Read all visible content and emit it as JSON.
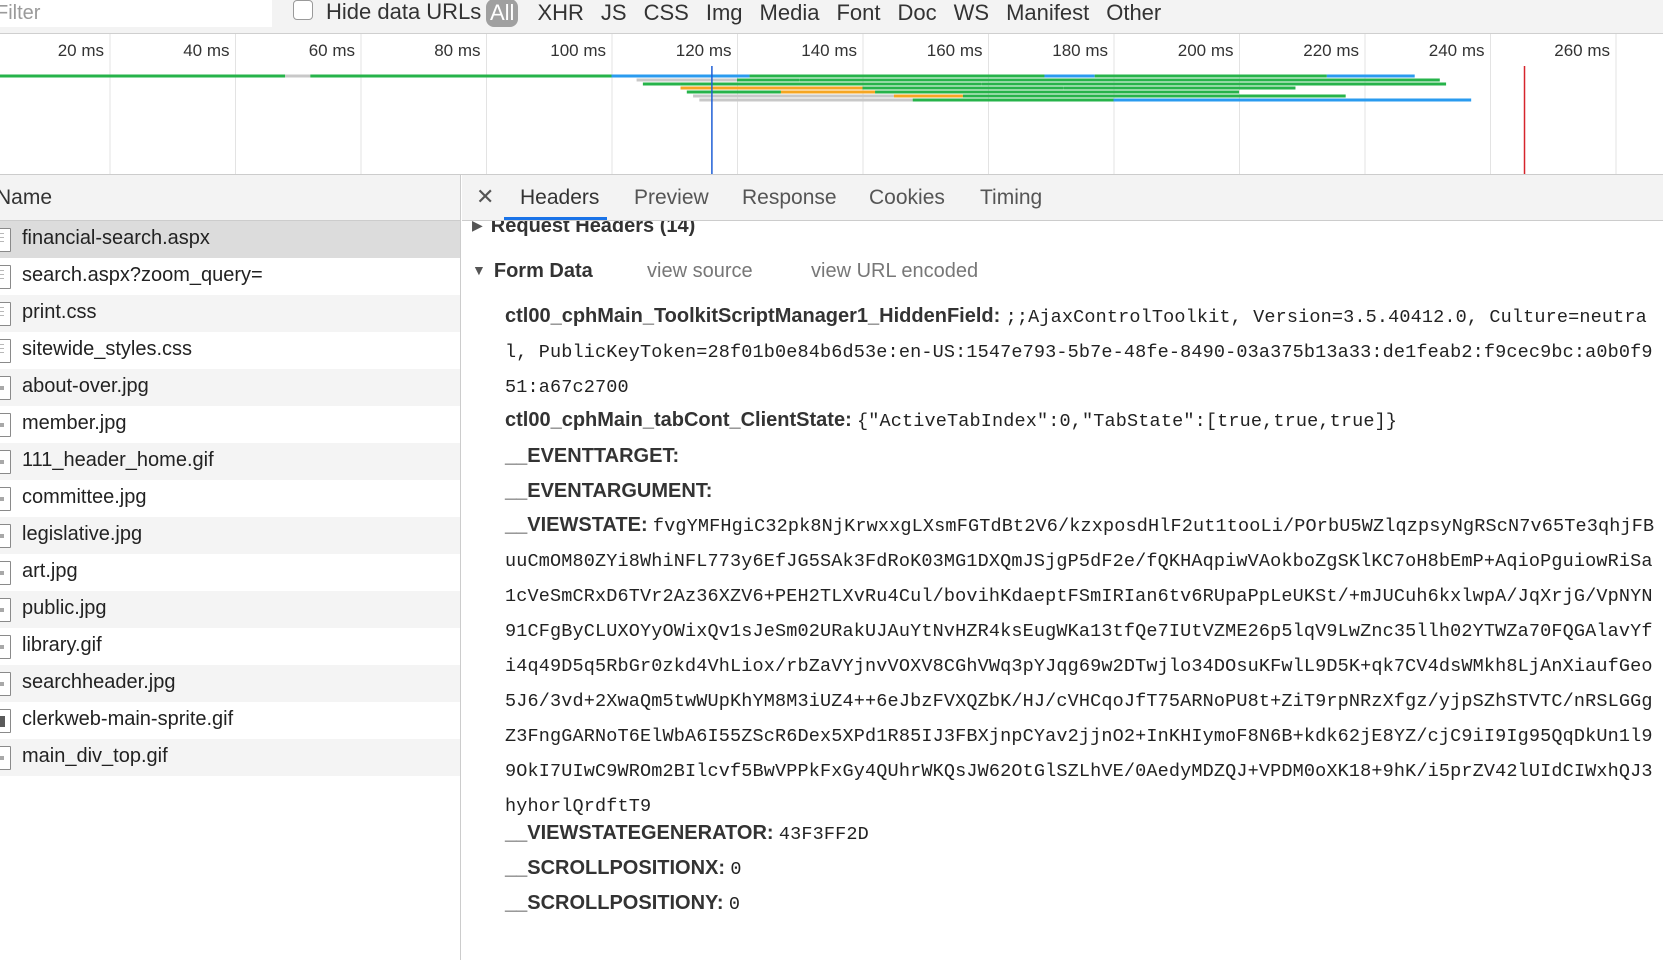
{
  "toolbar": {
    "filter_placeholder": "Filter",
    "hide_data_urls_label": "Hide data URLs",
    "type_filters": [
      "All",
      "XHR",
      "JS",
      "CSS",
      "Img",
      "Media",
      "Font",
      "Doc",
      "WS",
      "Manifest",
      "Other"
    ],
    "active_filter": "All"
  },
  "overview": {
    "tick_labels": [
      "20 ms",
      "40 ms",
      "60 ms",
      "80 ms",
      "100 ms",
      "120 ms",
      "140 ms",
      "160 ms",
      "180 ms",
      "200 ms",
      "220 ms",
      "240 ms",
      "260 ms"
    ],
    "colors": {
      "green": "#26b34a",
      "blue": "#2a9bef",
      "orange": "#f5a623",
      "gray": "#c8c8c8",
      "dom_line": "#1f5fd6",
      "load_line": "#d6242c"
    }
  },
  "request_list": {
    "header": "Name",
    "items": [
      {
        "name": "financial-search.aspx",
        "icon": "document-icon"
      },
      {
        "name": "search.aspx?zoom_query=",
        "icon": "document-icon"
      },
      {
        "name": "print.css",
        "icon": "document-icon"
      },
      {
        "name": "sitewide_styles.css",
        "icon": "document-icon"
      },
      {
        "name": "about-over.jpg",
        "icon": "image-icon"
      },
      {
        "name": "member.jpg",
        "icon": "image-icon"
      },
      {
        "name": "111_header_home.gif",
        "icon": "image-icon"
      },
      {
        "name": "committee.jpg",
        "icon": "image-icon"
      },
      {
        "name": "legislative.jpg",
        "icon": "image-icon"
      },
      {
        "name": "art.jpg",
        "icon": "image-icon"
      },
      {
        "name": "public.jpg",
        "icon": "image-icon"
      },
      {
        "name": "library.gif",
        "icon": "image-icon"
      },
      {
        "name": "searchheader.jpg",
        "icon": "image-icon"
      },
      {
        "name": "clerkweb-main-sprite.gif",
        "icon": "sprite-icon"
      },
      {
        "name": "main_div_top.gif",
        "icon": "image-icon"
      }
    ],
    "selected_index": 0
  },
  "details": {
    "close_glyph": "✕",
    "tabs": [
      "Headers",
      "Preview",
      "Response",
      "Cookies",
      "Timing"
    ],
    "active_tab": "Headers",
    "request_headers_title": "Request Headers (14)",
    "form_data_title": "Form Data",
    "view_source": "view source",
    "view_url_encoded": "view URL encoded",
    "form_data": [
      {
        "key": "ctl00_cphMain_ToolkitScriptManager1_HiddenField:",
        "value": ";;AjaxControlToolkit, Version=3.5.40412.0, Culture=neutral, PublicKeyToken=28f01b0e84b6d53e:en-US:1547e793-5b7e-48fe-8490-03a375b13a33:de1feab2:f9cec9bc:a0b0f951:a67c2700"
      },
      {
        "key": "ctl00_cphMain_tabCont_ClientState:",
        "value": "{\"ActiveTabIndex\":0,\"TabState\":[true,true,true]}"
      },
      {
        "key": "__EVENTTARGET:",
        "value": ""
      },
      {
        "key": "__EVENTARGUMENT:",
        "value": ""
      },
      {
        "key": "__VIEWSTATE:",
        "value": "fvgYMFHgiC32pk8NjKrwxxgLXsmFGTdBt2V6/kzxposdHlF2ut1tooLi/POrbU5WZlqzpsyNgRScN7v65Te3qhjFBuuCmOM80ZYi8WhiNFL773y6EfJG5SAk3FdRoK03MG1DXQmJSjgP5dF2e/fQKHAqpiwVAokboZgSKlKC7oH8bEmP+AqioPguiowRiSa1cVeSmCRxD6TVr2Az36XZV6+PEH2TLXvRu4Cul/bovihKdaeptFSmIRIan6tv6RUpaPpLeUKSt/+mJUCuh6kxlwpA/JqXrjG/VpNYN91CFgByCLUXOYyOWixQv1sJeSm02URakUJAuYtNvHZR4ksEugWKa13tfQe7IUtVZME26p5lqV9LwZnc35llh02YTWZa70FQGAlavYfi4q49D5q5RbGr0zkd4VhLiox/rbZaVYjnvVOXV8CGhVWq3pYJqg69w2DTwjlo34DOsuKFwlL9D5K+qk7CV4dsWMkh8LjAnXiaufGeo5J6/3vd+2XwaQm5twWUpKhYM8M3iUZ4++6eJbzFVXQZbK/HJ/cVHCqoJfT75ARNoPU8t+ZiT9rpNRzXfgz/yjpSZhSTVTC/nRSLGGgZ3FngGARNoT6ElWbA6I55ZScR6Dex5XPd1R85IJ3FBXjnpCYav2jjnO2+InKHIymoF8N6B+kdk62jE8YZ/cjC9iI9Ig95QqDkUn1l99OkI7UIwC9WROm2BIlcvf5BwVPPkFxGy4QUhrWKQsJW62OtGlSZLhVE/0AedyMDZQJ+VPDM0oXK18+9hK/i5prZV42lUIdCIWxhQJ3hyhorlQrdftT9"
      },
      {
        "key": "__VIEWSTATEGENERATOR:",
        "value": "43F3FF2D"
      },
      {
        "key": "__SCROLLPOSITIONX:",
        "value": "0"
      },
      {
        "key": "__SCROLLPOSITIONY:",
        "value": "0"
      }
    ]
  }
}
